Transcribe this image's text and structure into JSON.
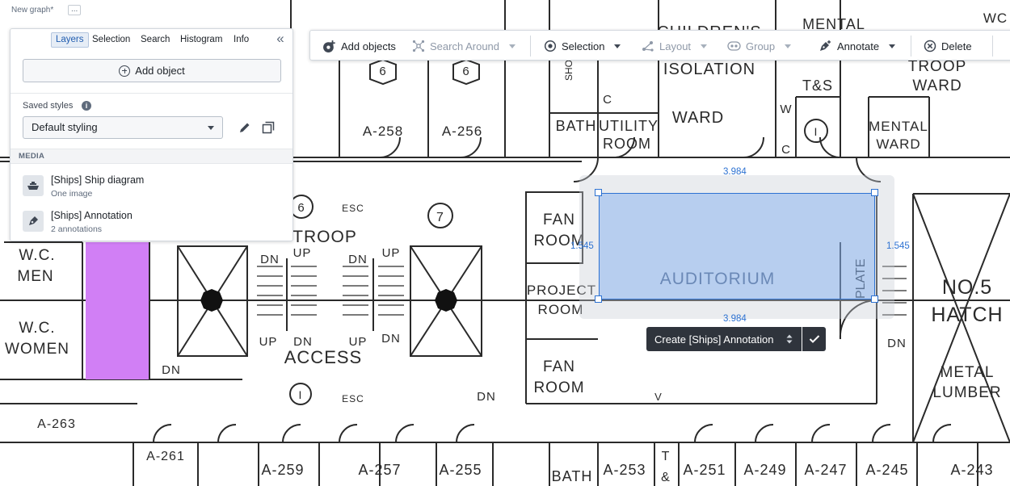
{
  "graph": {
    "title": "New graph*",
    "more": "..."
  },
  "panel": {
    "tabs": [
      {
        "label": "Layers",
        "active": true
      },
      {
        "label": "Selection"
      },
      {
        "label": "Search"
      },
      {
        "label": "Histogram"
      },
      {
        "label": "Info"
      }
    ],
    "collapse_icon": "double-chevron-left-icon",
    "add_object_label": "Add object",
    "saved_styles_label": "Saved styles",
    "style_value": "Default styling",
    "media_header": "MEDIA",
    "media": [
      {
        "title": "[Ships] Ship diagram",
        "subtitle": "One image",
        "icon": "ship-icon"
      },
      {
        "title": "[Ships] Annotation",
        "subtitle": "2 annotations",
        "icon": "annotation-pen-icon"
      }
    ]
  },
  "toolbar": {
    "add_objects": "Add objects",
    "search_around": "Search Around",
    "selection": "Selection",
    "layout": "Layout",
    "group": "Group",
    "annotate": "Annotate",
    "delete": "Delete"
  },
  "selection": {
    "width_top": "3.984",
    "width_bottom": "3.984",
    "height_left": "1.545",
    "height_right": "1.545",
    "create_label": "Create [Ships] Annotation"
  },
  "map": {
    "rooms": [
      "W.C.",
      "MEN",
      "W.C.",
      "WOMEN",
      "A-263",
      "A-261",
      "A-259",
      "A-257",
      "A-255",
      "BATH",
      "A-253",
      "T",
      "&",
      "A-251",
      "A-249",
      "A-247",
      "A-245",
      "A-243",
      "A-258",
      "A-256",
      "TROOP",
      "ACCESS",
      "DN",
      "UP",
      "FAN",
      "ROOM",
      "PROJECT",
      "ROOM",
      "FAN",
      "ROOM",
      "AUDITORIUM",
      "PLATE",
      "NO.5",
      "HATCH",
      "METAL",
      "LUMBER",
      "CHILDREN'S",
      "ISOLATION",
      "WARD",
      "T&S",
      "BATH",
      "UTILITY",
      "ROOM",
      "MENTAL",
      "WARD",
      "TROOP",
      "WARD",
      "MENTAL",
      "WARD",
      "6",
      "6",
      "6",
      "7",
      "W",
      "C",
      "C",
      "ESC",
      "ESC",
      "DN",
      "UP",
      "UP",
      "DN",
      "DN",
      "DN",
      "DN",
      "V",
      "V",
      "V"
    ],
    "accent": "#d17ff5"
  }
}
